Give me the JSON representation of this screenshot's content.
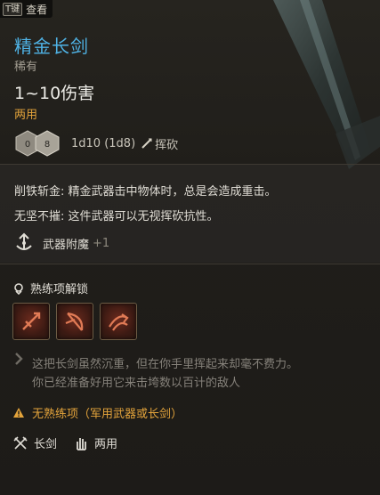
{
  "topbar": {
    "key": "T键",
    "label": "查看"
  },
  "item": {
    "name": "精金长剑",
    "rarity": "稀有",
    "damage": "1~10伤害",
    "handedness": "两用",
    "dice": {
      "left_face": "0",
      "right_face": "8"
    },
    "roll": "1d10 (1d8)",
    "damage_type": "挥砍"
  },
  "passives": [
    {
      "text": "削铁斩金: 精金武器击中物体时，总是会造成重击。"
    },
    {
      "text": "无坚不摧: 这件武器可以无视挥砍抗性。"
    }
  ],
  "enchant": {
    "label": "武器附魔",
    "count": "+1"
  },
  "mastery": {
    "label": "熟练项解锁",
    "actions": [
      "slash-action-icon",
      "bow-action-icon",
      "cleave-action-icon"
    ]
  },
  "flavor": {
    "line1": "这把长剑虽然沉重，但在你手里挥起来却毫不费力。",
    "line2": "你已经准备好用它来击垮数以百计的敌人"
  },
  "warning": {
    "text": "无熟练项（军用武器或长剑）"
  },
  "properties": {
    "weapon_type": "长剑",
    "hand": "两用"
  },
  "colors": {
    "title": "#4fb3e6",
    "accent": "#e4a43b",
    "text": "#e0ddd5",
    "muted": "#85817a"
  }
}
